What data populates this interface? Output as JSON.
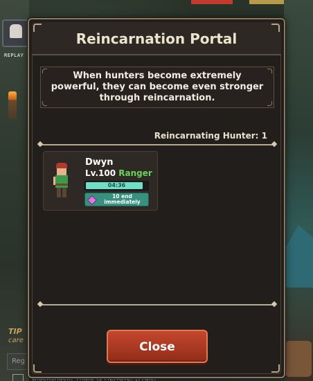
{
  "background": {
    "replay_label": "REPLAY",
    "tip_label": "TIP",
    "tip_text": "care",
    "input_placeholder": "Reg",
    "bottom_text": "Blackshack: Thalo is HEROIC: [Fruit!"
  },
  "modal": {
    "title": "Reincarnation Portal",
    "description": "When hunters become extremely powerful, they can become even stronger through reincarnation.",
    "count_label": "Reincarnating Hunter: 1",
    "close_label": "Close"
  },
  "hunters": [
    {
      "name": "Dwyn",
      "level": "Lv.100",
      "class": "Ranger",
      "timer": "04:36",
      "timer_progress": 0.92,
      "end_cost": "10",
      "end_label": "end immediately"
    }
  ],
  "colors": {
    "accent_green": "#6bd35a",
    "timer_fill": "#6fe0c7",
    "end_button": "#38907f",
    "close_button": "#b13c25",
    "gem": "#d97be3"
  },
  "icons": {
    "gem": "gem-icon"
  }
}
